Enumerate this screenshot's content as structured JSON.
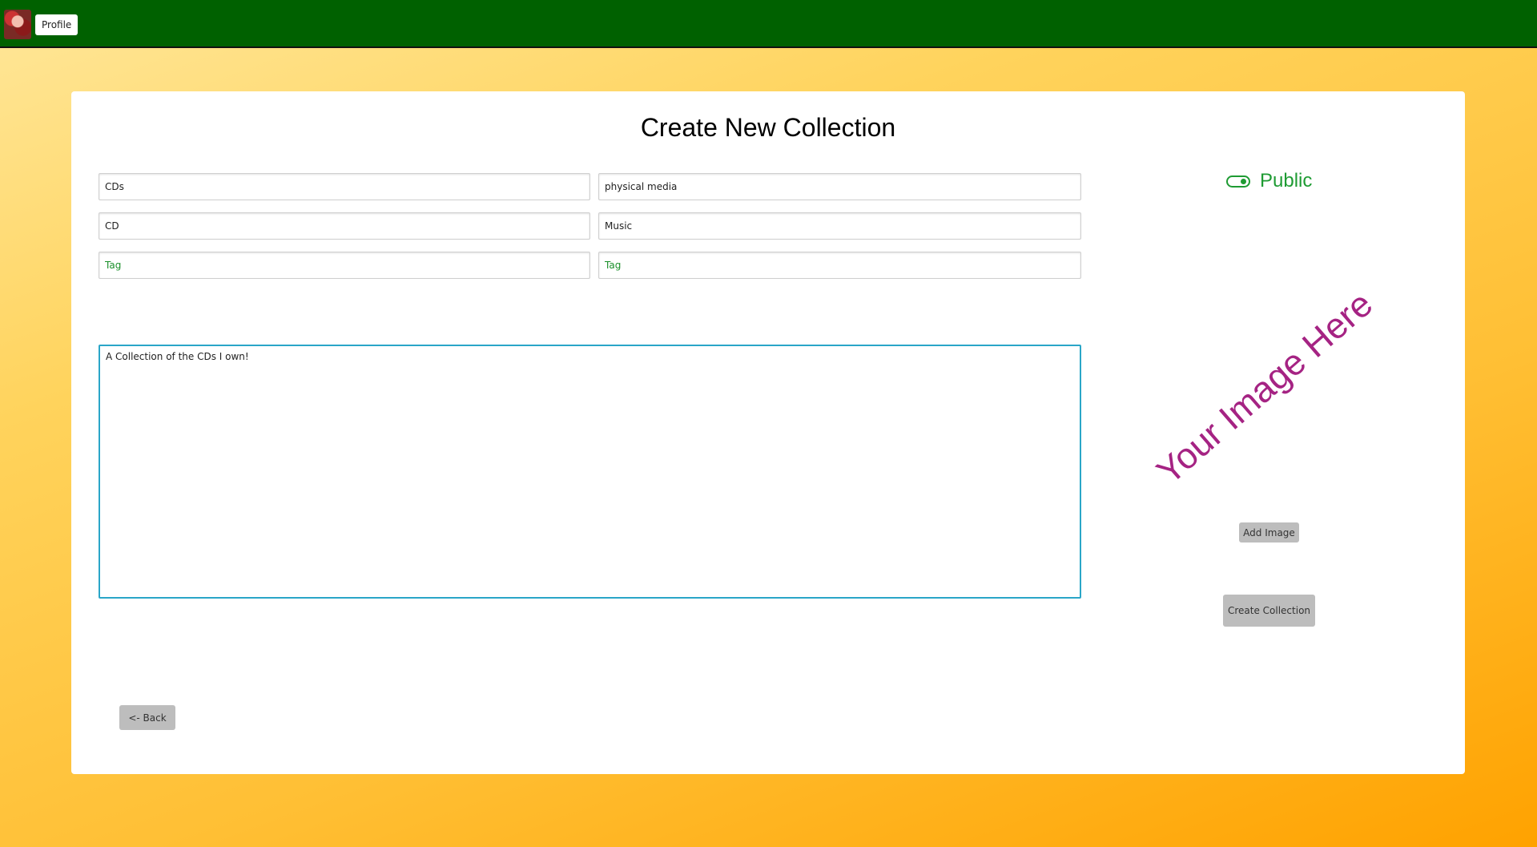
{
  "header": {
    "avatar_icon": "user-avatar-icon",
    "profile_label": "Profile",
    "background_color": "#006100"
  },
  "form": {
    "title": "Create New Collection",
    "fields": {
      "name": {
        "value": "CDs"
      },
      "category": {
        "value": "physical media"
      },
      "item_type": {
        "value": "CD"
      },
      "genre": {
        "value": "Music"
      },
      "tag1": {
        "value": "",
        "placeholder": "Tag"
      },
      "tag2": {
        "value": "",
        "placeholder": "Tag"
      }
    },
    "description": "A Collection of the CDs I own!"
  },
  "visibility": {
    "label": "Public",
    "enabled": true,
    "color": "#1e9b33"
  },
  "image": {
    "placeholder_text": "Your Image Here",
    "placeholder_color": "#a52383",
    "add_label": "Add Image"
  },
  "actions": {
    "create_label": "Create Collection",
    "back_label": "<- Back"
  }
}
